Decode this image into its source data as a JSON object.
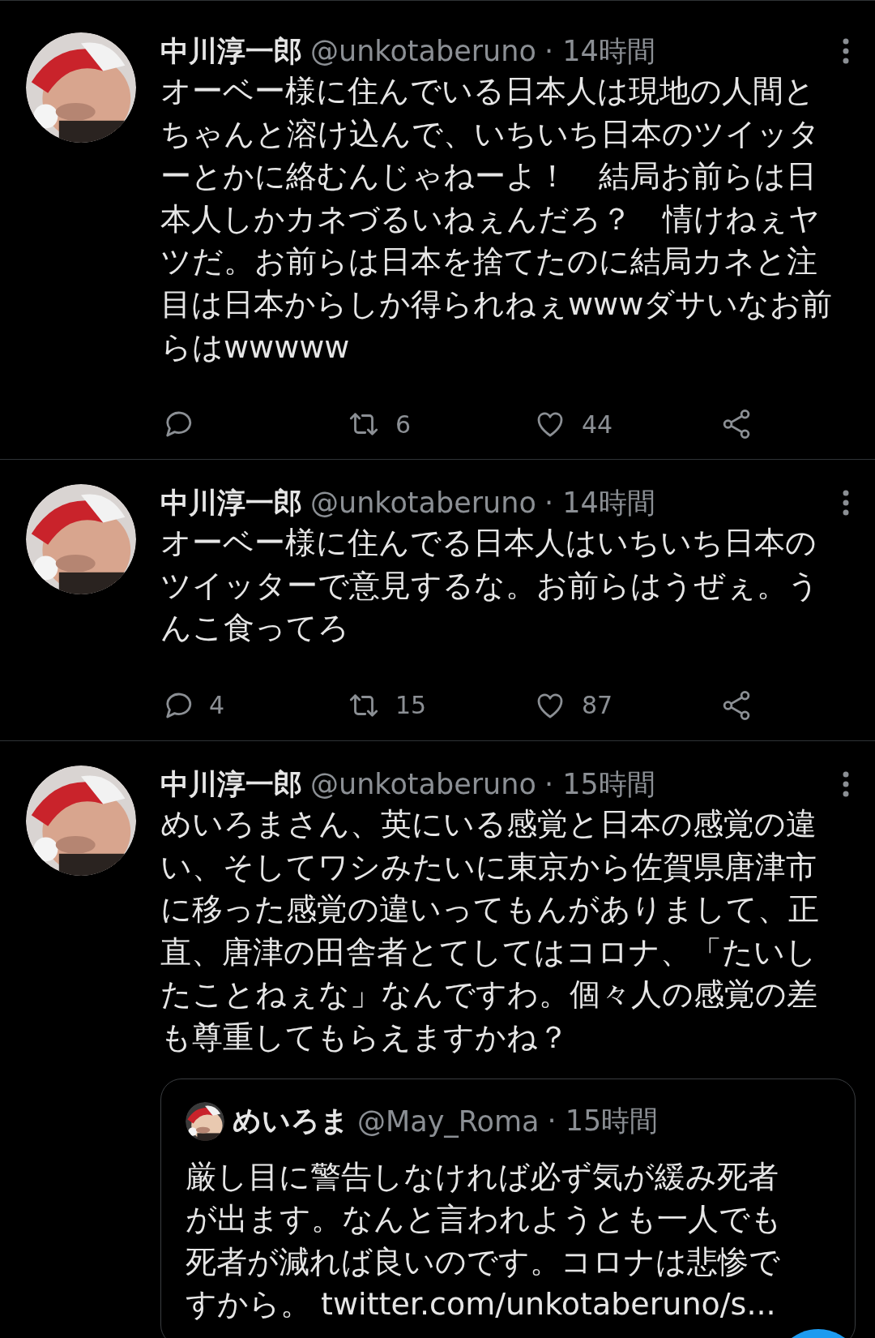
{
  "tweets": [
    {
      "name": "中川淳一郎",
      "handle": "@unkotaberuno",
      "time": "· 14時間",
      "text": "オーベー様に住んでいる日本人は現地の人間とちゃんと溶け込んで、いちいち日本のツイッターとかに絡むんじゃねーよ！　結局お前らは日本人しかカネづるいねぇんだろ？　情けねぇヤツだ。お前らは日本を捨てたのに結局カネと注目は日本からしか得られねぇwwwダサいなお前らはwwwww",
      "actions": {
        "retweets": "6",
        "likes": "44"
      }
    },
    {
      "name": "中川淳一郎",
      "handle": "@unkotaberuno",
      "time": "· 14時間",
      "text": "オーベー様に住んでる日本人はいちいち日本のツイッターで意見するな。お前らはうぜぇ。うんこ食ってろ",
      "actions": {
        "replies": "4",
        "retweets": "15",
        "likes": "87"
      }
    },
    {
      "name": "中川淳一郎",
      "handle": "@unkotaberuno",
      "time": "· 15時間",
      "text": "めいろまさん、英にいる感覚と日本の感覚の違い、そしてワシみたいに東京から佐賀県唐津市に移った感覚の違いってもんがありまして、正直、唐津の田舎者とてしてはコロナ、「たいしたことねぇな」なんですわ。個々人の感覚の差も尊重してもらえますかね？",
      "quote": {
        "name": "めいろま",
        "handle": "@May_Roma",
        "time": "· 15時間",
        "text": "厳し目に警告しなければ必ず気が緩み死者が出ます。なんと言われようとも一人でも死者が減れば良いのです。コロナは悲惨ですから。",
        "link": "twitter.com/unkotaberuno/s..."
      }
    }
  ]
}
